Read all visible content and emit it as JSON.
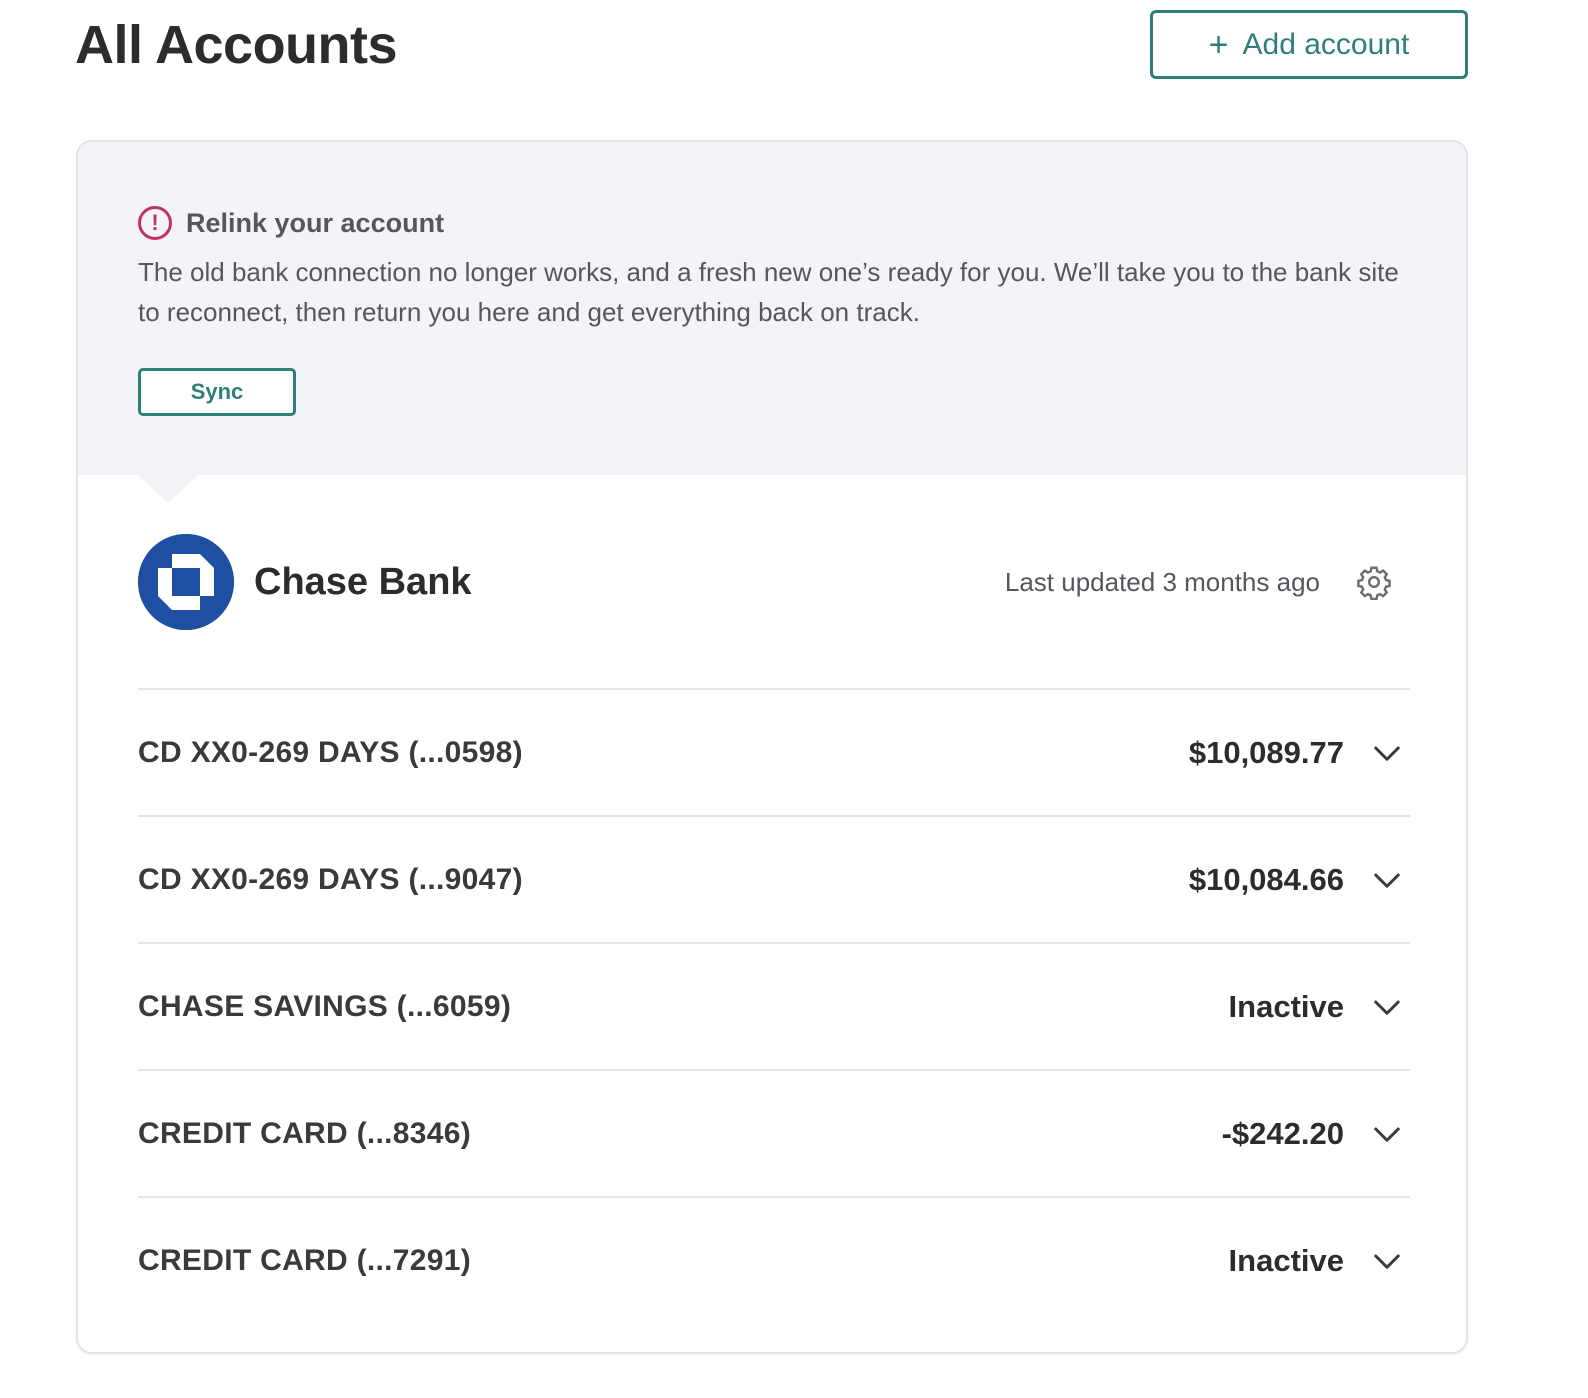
{
  "header": {
    "title": "All Accounts",
    "add_button_label": "Add account",
    "add_icon": "plus-icon"
  },
  "alert": {
    "icon": "alert-circle-icon",
    "title": "Relink your account",
    "body": "The old bank connection no longer works, and a fresh new one’s ready for you. We’ll take you to the bank site to reconnect, then return you here and get everything back on track.",
    "sync_label": "Sync",
    "icon_color": "#c6325f"
  },
  "bank": {
    "name": "Chase Bank",
    "last_updated": "Last updated 3 months ago",
    "logo_color": "#1f4fa3",
    "settings_icon": "gear-icon"
  },
  "accounts": [
    {
      "name": "CD XX0-269 DAYS (...0598)",
      "value": "$10,089.77"
    },
    {
      "name": "CD XX0-269 DAYS (...9047)",
      "value": "$10,084.66"
    },
    {
      "name": "CHASE SAVINGS (...6059)",
      "value": "Inactive"
    },
    {
      "name": "CREDIT CARD (...8346)",
      "value": "-$242.20"
    },
    {
      "name": "CREDIT CARD (...7291)",
      "value": "Inactive"
    }
  ],
  "theme": {
    "accent": "#2f7f79",
    "alert_bg": "#f3f4f7"
  }
}
